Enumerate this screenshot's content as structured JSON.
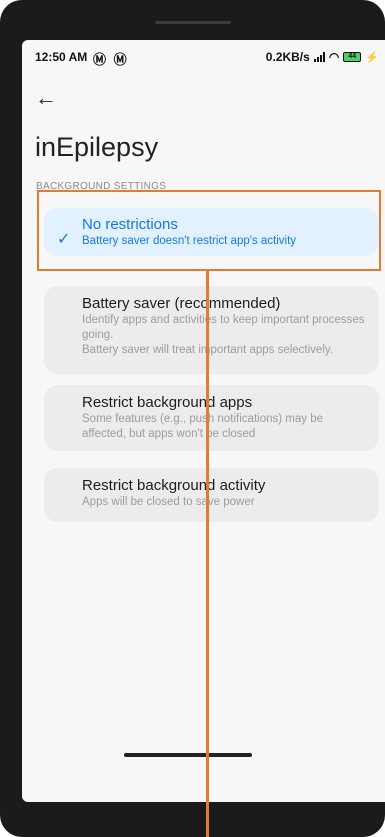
{
  "status_bar": {
    "time": "12:50 AM",
    "left_icons": "Ⓜ Ⓜ",
    "net_speed": "0.2KB/s",
    "battery": "44"
  },
  "header": {
    "back_icon": "back-arrow-icon",
    "title": "inEpilepsy"
  },
  "section": {
    "label": "BACKGROUND SETTINGS"
  },
  "options": [
    {
      "title": "No restrictions",
      "description": "Battery saver doesn't restrict app's activity",
      "selected": true
    },
    {
      "title": "Battery saver (recommended)",
      "description": "Identify apps and activities to keep important processes going.\nBattery saver will treat important apps selectively.",
      "selected": false
    },
    {
      "title": "Restrict background apps",
      "description": "Some features (e.g., push notifications) may be affected, but apps won't be closed",
      "selected": false
    },
    {
      "title": "Restrict background activity",
      "description": "Apps will be closed to save power",
      "selected": false
    }
  ],
  "colors": {
    "accent": "#1478e6",
    "selected_bg": "#e2f1ff",
    "annotation": "#e37b32"
  }
}
